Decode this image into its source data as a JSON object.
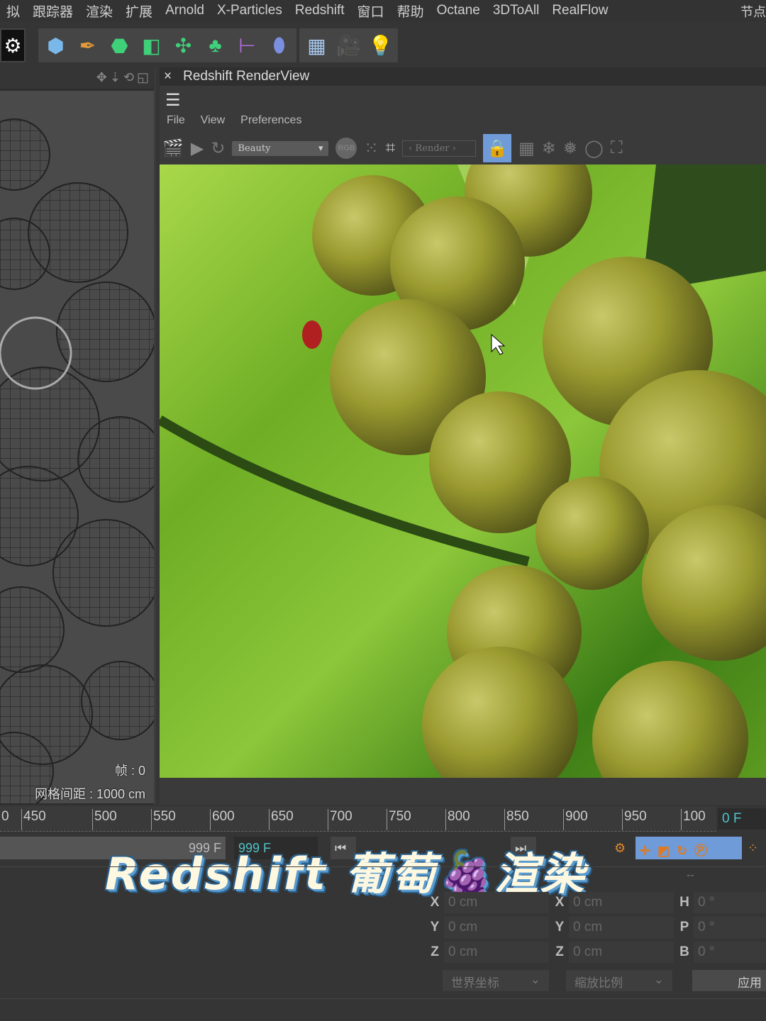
{
  "menubar": {
    "items": [
      "拟",
      "跟踪器",
      "渲染",
      "扩展",
      "Arnold",
      "X-Particles",
      "Redshift",
      "窗口",
      "帮助",
      "Octane",
      "3DToAll",
      "RealFlow"
    ],
    "right": "节点"
  },
  "toolbar": {
    "icons": [
      "render-settings-icon",
      "cube-icon",
      "pen-icon",
      "subdivision-icon",
      "extrude-icon",
      "array-icon",
      "cloner-icon",
      "deformer-icon",
      "bend-icon",
      "floor-icon",
      "camera-icon",
      "light-icon"
    ]
  },
  "viewport": {
    "frame_label": "帧 : 0",
    "grid_label": "网格间距 : 1000 cm"
  },
  "renderview": {
    "title": "Redshift RenderView",
    "close": "×",
    "menu": [
      "File",
      "View",
      "Preferences"
    ],
    "aov": "Beauty",
    "rgb": "RGB",
    "render_sel": "‹ Render ›"
  },
  "timeline": {
    "ticks": [
      "0",
      "450",
      "500",
      "550",
      "600",
      "650",
      "700",
      "750",
      "800",
      "850",
      "900",
      "950",
      "100"
    ],
    "current_frame": "0 F",
    "end_frame": "999 F",
    "end_frame2": "999 F"
  },
  "overlay_title": "Redshift 葡萄🍇渲染",
  "coords": {
    "rows": [
      {
        "a": "X",
        "av": "0 cm",
        "b": "X",
        "bv": "0 cm",
        "c": "H",
        "cv": "0 °"
      },
      {
        "a": "Y",
        "av": "0 cm",
        "b": "Y",
        "bv": "0 cm",
        "c": "P",
        "cv": "0 °"
      },
      {
        "a": "Z",
        "av": "0 cm",
        "b": "Z",
        "bv": "0 cm",
        "c": "B",
        "cv": "0 °"
      }
    ],
    "space": "世界坐标",
    "scale": "缩放比例",
    "apply": "应用",
    "dash": "--"
  },
  "colors": {
    "accent": "#6f9bd8",
    "frame": "#4fc3c8"
  }
}
